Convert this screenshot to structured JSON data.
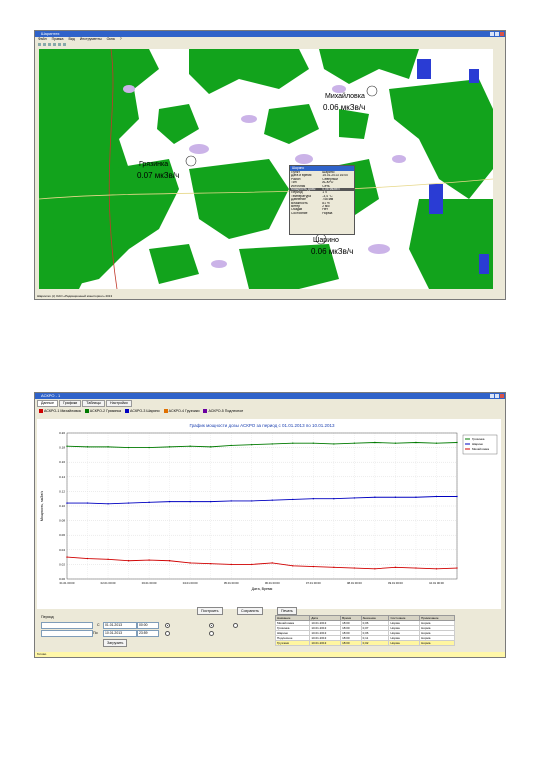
{
  "map_window": {
    "title": "Шаринтех",
    "menu": [
      "Файл",
      "Правка",
      "Вид",
      "Инструменты",
      "Окна",
      "?"
    ],
    "status_text": "Шаринтех (c) ОАО «Радиационный мониторинг» 2013",
    "stations": [
      {
        "name": "Михайловка",
        "value": "0.06 мкЗв/ч"
      },
      {
        "name": "Грязинка",
        "value": "0.07 мкЗв/ч"
      },
      {
        "name": "Шарино",
        "value": "0.06 мкЗв/ч"
      }
    ],
    "popup": {
      "title": "Шарино",
      "rows": [
        [
          "Пункт",
          "Шарино"
        ],
        [
          "Дата и время",
          "15.01.2013 16:00"
        ],
        [
          "Район",
          "Северный"
        ],
        [
          "Тип",
          "АСКРО"
        ],
        [
          "Источник",
          "Сеть"
        ],
        [
          "Мощность дозы",
          "0,06 мкЗв/ч"
        ],
        [
          "Период",
          "1 ч"
        ],
        [
          "Температура",
          "-3,4 °С"
        ],
        [
          "Давление",
          "745 мм"
        ],
        [
          "Влажность",
          "81 %"
        ],
        [
          "Ветер",
          "2 м/с"
        ],
        [
          "Осадки",
          "Нет"
        ],
        [
          "Состояние",
          "Норма"
        ]
      ]
    }
  },
  "chart_window": {
    "title": "АСКРО - 1",
    "tabs": [
      "Данные",
      "Графики",
      "Таблицы",
      "Настройки"
    ],
    "stations": [
      {
        "name": "АСКРО-1 Михайловка",
        "color": "#d00000"
      },
      {
        "name": "АСКРО-2 Грязинка",
        "color": "#007a00"
      },
      {
        "name": "АСКРО-3 Шарино",
        "color": "#0000c0"
      },
      {
        "name": "АСКРО-4 Грузчики",
        "color": "#e07000"
      },
      {
        "name": "АСКРО-5 Подлесное",
        "color": "#6a00a0"
      }
    ],
    "chart_data": {
      "type": "line",
      "title": "График мощности дозы АСКРО за период с 01.01.2013 по 10.01.2013",
      "xlabel": "Дата, Время",
      "ylabel": "Мощность, мкЗв/ч",
      "ylim": [
        0,
        0.2
      ],
      "x": [
        "01.01 00:00",
        "01.01 12:00",
        "02.01 00:00",
        "02.01 12:00",
        "03.01 00:00",
        "03.01 12:00",
        "04.01 00:00",
        "04.01 12:00",
        "05.01 00:00",
        "05.01 12:00",
        "06.01 00:00",
        "06.01 12:00",
        "07.01 00:00",
        "07.01 12:00",
        "08.01 00:00",
        "08.01 12:00",
        "09.01 00:00",
        "09.01 12:00",
        "10.01 00:00",
        "10.01 12:00"
      ],
      "series": [
        {
          "name": "Грязинка",
          "color": "#007a00",
          "values": [
            0.182,
            0.181,
            0.181,
            0.18,
            0.18,
            0.181,
            0.182,
            0.181,
            0.183,
            0.184,
            0.185,
            0.186,
            0.186,
            0.185,
            0.186,
            0.187,
            0.186,
            0.187,
            0.186,
            0.187
          ]
        },
        {
          "name": "Шарино",
          "color": "#0000c0",
          "values": [
            0.104,
            0.104,
            0.103,
            0.104,
            0.105,
            0.106,
            0.106,
            0.106,
            0.107,
            0.107,
            0.108,
            0.109,
            0.11,
            0.11,
            0.111,
            0.112,
            0.112,
            0.112,
            0.113,
            0.113
          ]
        },
        {
          "name": "Михайловка",
          "color": "#d00000",
          "values": [
            0.03,
            0.028,
            0.027,
            0.025,
            0.026,
            0.025,
            0.022,
            0.021,
            0.02,
            0.02,
            0.022,
            0.018,
            0.017,
            0.016,
            0.015,
            0.014,
            0.016,
            0.015,
            0.014,
            0.015
          ]
        }
      ],
      "legend": "top-right",
      "grid": true
    },
    "controls": {
      "buttons": [
        "Построить",
        "Сохранить",
        "Печать"
      ],
      "period_label": "Период",
      "from_label": "С",
      "to_label": "По",
      "date_from": "01.01.2013",
      "date_to": "10.01.2013",
      "time_from": "00:00",
      "time_to": "23:59",
      "action_button": "Загрузить"
    },
    "table": {
      "headers": [
        "Название",
        "Дата",
        "Время",
        "Значение",
        "Состояние",
        "Примечание"
      ],
      "rows": [
        [
          "Михайловка",
          "10.01.2013",
          "18:00",
          "0,06",
          "Норма",
          "Норма"
        ],
        [
          "Грязинка",
          "10.01.2013",
          "18:00",
          "0,07",
          "Норма",
          "Норма"
        ],
        [
          "Шарино",
          "10.01.2013",
          "18:00",
          "0,06",
          "Норма",
          "Норма"
        ],
        [
          "Подлесное",
          "10.01.2013",
          "18:00",
          "0,11",
          "Норма",
          "Норма"
        ],
        [
          "Грузчики",
          "10.01.2013",
          "18:00",
          "0,02",
          "Норма",
          "Норма"
        ]
      ]
    },
    "status_text": "Готово"
  }
}
